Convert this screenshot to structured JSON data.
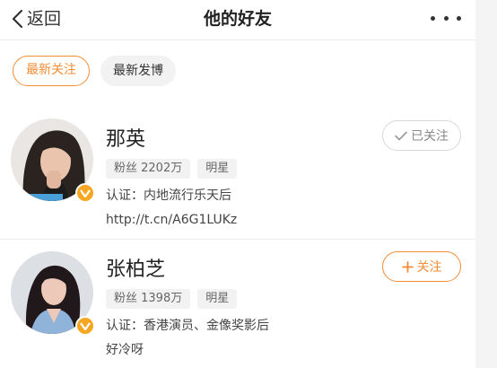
{
  "header": {
    "back_label": "返回",
    "title": "他的好友"
  },
  "filters": [
    {
      "label": "最新关注",
      "active": true
    },
    {
      "label": "最新发博",
      "active": false
    }
  ],
  "users": [
    {
      "name": "那英",
      "fans": "粉丝 2202万",
      "category": "明星",
      "verification": "认证：内地流行乐天后",
      "bio": "http://t.cn/A6G1LUKz",
      "follow_label": "已关注",
      "followed": true,
      "verified_badge": "v-badge-icon"
    },
    {
      "name": "张柏芝",
      "fans": "粉丝 1398万",
      "category": "明星",
      "verification": "认证：香港演员、金像奖影后",
      "bio": "好冷呀",
      "follow_label": "关注",
      "followed": false,
      "verified_badge": "v-badge-icon"
    }
  ],
  "colors": {
    "accent": "#f28c35",
    "badge": "#f5a623",
    "tag_bg": "#f2f2f2",
    "divider": "#ececec"
  }
}
